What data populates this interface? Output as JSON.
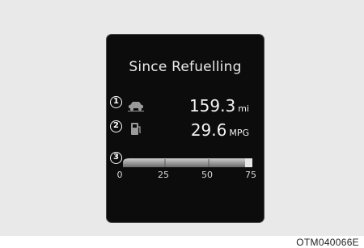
{
  "screen": {
    "title": "Since Refuelling",
    "distance": {
      "callout": "1",
      "icon": "car-distance-icon",
      "value": "159.3",
      "unit": "mi"
    },
    "economy": {
      "callout": "2",
      "icon": "fuel-pump-icon",
      "value": "29.6",
      "unit": "MPG"
    },
    "gauge": {
      "callout": "3",
      "scale": [
        "0",
        "25",
        "50",
        "75"
      ]
    }
  },
  "figure_code": "OTM040066E",
  "colors": {
    "background": "#e9e9e9",
    "screen": "#0c0c0c",
    "text": "#f2f2f2"
  }
}
